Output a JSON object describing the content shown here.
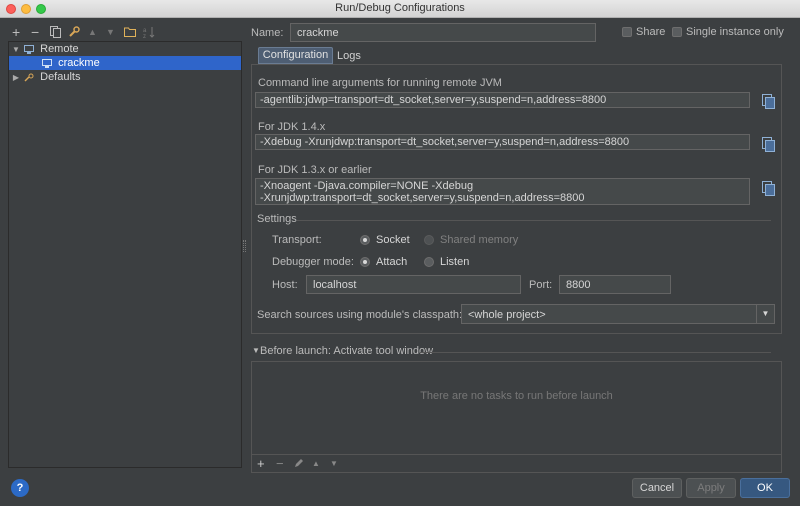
{
  "window": {
    "title": "Run/Debug Configurations"
  },
  "toolbar": {
    "icons": [
      "add-icon",
      "remove-icon",
      "copy-icon",
      "wrench-icon",
      "move-up-icon",
      "move-down-icon",
      "folder-icon",
      "sort-icon"
    ],
    "add": "+",
    "remove": "−",
    "up": "▲",
    "down": "▼"
  },
  "tree": {
    "items": [
      {
        "label": "Remote"
      },
      {
        "label": "crackme"
      },
      {
        "label": "Defaults"
      }
    ]
  },
  "form": {
    "name_label": "Name:",
    "name_value": "crackme",
    "share_label": "Share",
    "single_instance_label": "Single instance only"
  },
  "tabs": [
    {
      "label": "Configuration"
    },
    {
      "label": "Logs"
    }
  ],
  "config": {
    "cmdline_label": "Command line arguments for running remote JVM",
    "cmdline_value": "-agentlib:jdwp=transport=dt_socket,server=y,suspend=n,address=8800",
    "jdk14_label": "For JDK 1.4.x",
    "jdk14_value": "-Xdebug -Xrunjdwp:transport=dt_socket,server=y,suspend=n,address=8800",
    "jdk13_label": "For JDK 1.3.x or earlier",
    "jdk13_line1": "-Xnoagent -Djava.compiler=NONE -Xdebug",
    "jdk13_line2": "-Xrunjdwp:transport=dt_socket,server=y,suspend=n,address=8800",
    "settings_label": "Settings",
    "transport_label": "Transport:",
    "transport_socket": "Socket",
    "transport_shared": "Shared memory",
    "debugger_label": "Debugger mode:",
    "debugger_attach": "Attach",
    "debugger_listen": "Listen",
    "host_label": "Host:",
    "host_value": "localhost",
    "port_label": "Port:",
    "port_value": "8800",
    "classpath_label": "Search sources using module's classpath:",
    "classpath_value": "<whole project>"
  },
  "before_launch": {
    "title": "Before launch: Activate tool window",
    "empty_text": "There are no tasks to run before launch",
    "add": "+",
    "remove": "−",
    "up": "▲",
    "down": "▼"
  },
  "buttons": {
    "help": "?",
    "cancel": "Cancel",
    "apply": "Apply",
    "ok": "OK"
  },
  "colors": {
    "background": "#3c3f41",
    "selection": "#2f65ca",
    "ok_button": "#365880"
  }
}
